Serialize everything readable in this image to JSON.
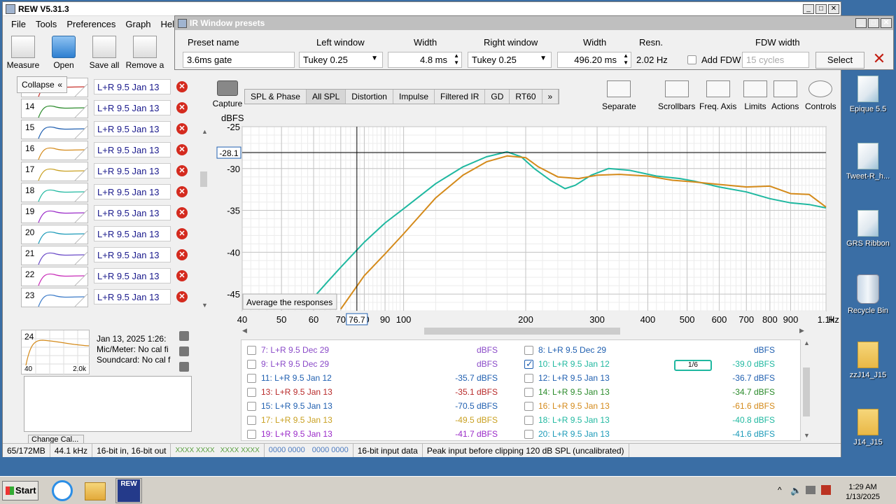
{
  "window": {
    "title": "REW V5.31.3"
  },
  "menu": [
    "File",
    "Tools",
    "Preferences",
    "Graph",
    "Help"
  ],
  "toolbar": [
    "Measure",
    "Open",
    "Save all",
    "Remove a"
  ],
  "leftpanel": {
    "collapse_label": "Collapse",
    "rows": [
      {
        "num": "13",
        "name": "L+R 9.5 Jan 13",
        "color": "#c8302a"
      },
      {
        "num": "14",
        "name": "L+R 9.5 Jan 13",
        "color": "#2a8a2a"
      },
      {
        "num": "15",
        "name": "L+R 9.5 Jan 13",
        "color": "#1f5fb0"
      },
      {
        "num": "16",
        "name": "L+R 9.5 Jan 13",
        "color": "#d48a1a"
      },
      {
        "num": "17",
        "name": "L+R 9.5 Jan 13",
        "color": "#c9a020"
      },
      {
        "num": "18",
        "name": "L+R 9.5 Jan 13",
        "color": "#1fb8a0"
      },
      {
        "num": "19",
        "name": "L+R 9.5 Jan 13",
        "color": "#9a2ac8"
      },
      {
        "num": "20",
        "name": "L+R 9.5 Jan 13",
        "color": "#1a9ab8"
      },
      {
        "num": "21",
        "name": "L+R 9.5 Jan 13",
        "color": "#6a4ac8"
      },
      {
        "num": "22",
        "name": "L+R 9.5 Jan 13",
        "color": "#c82ab8"
      },
      {
        "num": "23",
        "name": "L+R 9.5 Jan 13",
        "color": "#3a7ac8"
      }
    ],
    "selected": {
      "num": "24",
      "axis_start": "40",
      "axis_end": "2.0k",
      "line1": "Jan 13, 2025 1:26:",
      "line2": "Mic/Meter: No cal fi",
      "line3": "Soundcard: No cal f",
      "change_cal": "Change Cal..."
    }
  },
  "ir_presets": {
    "title": "IR Window presets",
    "headers": {
      "preset_name": "Preset name",
      "left_window": "Left window",
      "width": "Width",
      "right_window": "Right window",
      "width2": "Width",
      "resn": "Resn.",
      "fdw_width": "FDW width"
    },
    "preset_value": "3.6ms gate",
    "left_window_value": "Tukey 0.25",
    "left_width": "4.8 ms",
    "right_window_value": "Tukey 0.25",
    "right_width": "496.20 ms",
    "resn_value": "2.02 Hz",
    "add_fdw": "Add FDW",
    "fdw_cycles": "15 cycles",
    "select_label": "Select"
  },
  "graph": {
    "capture_label": "Capture",
    "tabs": [
      "SPL & Phase",
      "All SPL",
      "Distortion",
      "Impulse",
      "Filtered IR",
      "GD",
      "RT60",
      "»"
    ],
    "active_tab": "All SPL",
    "tools": [
      "Separate",
      "Scrollbars",
      "Freq. Axis",
      "Limits",
      "Actions",
      "Controls"
    ],
    "average_label": "Average the responses",
    "cursor_db": "-28.1",
    "cursor_hz": "76.7"
  },
  "chart_data": {
    "type": "line",
    "ylabel": "dBFS",
    "xunit": "kHz",
    "x_log": true,
    "xlim": [
      40,
      1100
    ],
    "ylim": [
      -47,
      -25
    ],
    "x_ticks": [
      "40",
      "50",
      "60",
      "70",
      "80",
      "90",
      "100",
      "200",
      "300",
      "400",
      "500",
      "600",
      "700",
      "800",
      "900",
      "1.1k"
    ],
    "y_ticks": [
      "-25",
      "-30",
      "-35",
      "-40",
      "-45"
    ],
    "cursor": {
      "x": 76.7,
      "y": -28.1
    },
    "grid": true,
    "series": [
      {
        "name": "10: L+R 9.5 Jan 12",
        "color": "#1fb8a0",
        "points": [
          [
            59,
            -45.8
          ],
          [
            65,
            -43.5
          ],
          [
            70,
            -41.8
          ],
          [
            80,
            -38.8
          ],
          [
            90,
            -36.5
          ],
          [
            100,
            -34.8
          ],
          [
            120,
            -31.8
          ],
          [
            140,
            -29.8
          ],
          [
            160,
            -28.6
          ],
          [
            180,
            -28.0
          ],
          [
            195,
            -28.6
          ],
          [
            210,
            -30.0
          ],
          [
            230,
            -31.4
          ],
          [
            250,
            -32.4
          ],
          [
            265,
            -32.0
          ],
          [
            290,
            -30.8
          ],
          [
            320,
            -30.0
          ],
          [
            360,
            -30.2
          ],
          [
            420,
            -30.9
          ],
          [
            480,
            -31.2
          ],
          [
            520,
            -31.5
          ],
          [
            600,
            -32.2
          ],
          [
            700,
            -32.8
          ],
          [
            800,
            -33.6
          ],
          [
            900,
            -34.1
          ],
          [
            1000,
            -34.3
          ],
          [
            1100,
            -34.7
          ]
        ]
      },
      {
        "name": "16: L+R 9.5 Jan 13",
        "color": "#d48a1a",
        "points": [
          [
            70,
            -46.8
          ],
          [
            80,
            -42.8
          ],
          [
            90,
            -40.2
          ],
          [
            100,
            -37.8
          ],
          [
            120,
            -33.5
          ],
          [
            140,
            -30.8
          ],
          [
            160,
            -29.2
          ],
          [
            180,
            -28.5
          ],
          [
            200,
            -28.7
          ],
          [
            215,
            -29.8
          ],
          [
            240,
            -31.0
          ],
          [
            270,
            -31.2
          ],
          [
            300,
            -30.8
          ],
          [
            340,
            -30.7
          ],
          [
            400,
            -30.9
          ],
          [
            460,
            -31.4
          ],
          [
            520,
            -31.6
          ],
          [
            600,
            -31.9
          ],
          [
            700,
            -32.2
          ],
          [
            800,
            -32.1
          ],
          [
            900,
            -33.0
          ],
          [
            1000,
            -33.1
          ],
          [
            1100,
            -34.6
          ]
        ]
      }
    ]
  },
  "meas_table": [
    {
      "cb": false,
      "label": "7: L+R 9.5 Dec 29",
      "value": "dBFS",
      "color": "#8a4ac8",
      "col": 0,
      "row": 0
    },
    {
      "cb": false,
      "label": "8: L+R 9.5 Dec 29",
      "value": "dBFS",
      "color": "#1f5fb0",
      "col": 1,
      "row": 0
    },
    {
      "cb": false,
      "label": "9: L+R 9.5 Dec 29",
      "value": "dBFS",
      "color": "#8a4ac8",
      "col": 0,
      "row": 1
    },
    {
      "cb": true,
      "label": "10: L+R 9.5 Jan 12",
      "value": "-39.0 dBFS",
      "color": "#1fb8a0",
      "col": 1,
      "row": 1
    },
    {
      "cb": false,
      "label": "11: L+R 9.5 Jan 12",
      "value": "-35.7 dBFS",
      "color": "#1f5fb0",
      "col": 0,
      "row": 2
    },
    {
      "cb": false,
      "label": "12: L+R 9.5 Jan 13",
      "value": "-36.7 dBFS",
      "color": "#1f5fb0",
      "col": 1,
      "row": 2
    },
    {
      "cb": false,
      "label": "13: L+R 9.5 Jan 13",
      "value": "-35.1 dBFS",
      "color": "#b82a2a",
      "col": 0,
      "row": 3
    },
    {
      "cb": false,
      "label": "14: L+R 9.5 Jan 13",
      "value": "-34.7 dBFS",
      "color": "#2a8a2a",
      "col": 1,
      "row": 3
    },
    {
      "cb": false,
      "label": "15: L+R 9.5 Jan 13",
      "value": "-70.5 dBFS",
      "color": "#1f5fb0",
      "col": 0,
      "row": 4
    },
    {
      "cb": false,
      "label": "16: L+R 9.5 Jan 13",
      "value": "-61.6 dBFS",
      "color": "#d48a1a",
      "col": 1,
      "row": 4
    },
    {
      "cb": false,
      "label": "17: L+R 9.5 Jan 13",
      "value": "-49.5 dBFS",
      "color": "#c9a020",
      "col": 0,
      "row": 5
    },
    {
      "cb": false,
      "label": "18: L+R 9.5 Jan 13",
      "value": "-40.8 dBFS",
      "color": "#1fb8a0",
      "col": 1,
      "row": 5
    },
    {
      "cb": false,
      "label": "19: L+R 9.5 Jan 13",
      "value": "-41.7 dBFS",
      "color": "#9a2ac8",
      "col": 0,
      "row": 6
    },
    {
      "cb": false,
      "label": "20: L+R 9.5 Jan 13",
      "value": "-41.6 dBFS",
      "color": "#1a9ab8",
      "col": 1,
      "row": 6
    }
  ],
  "smoothing_label": "1/6",
  "statusbar": [
    "65/172MB",
    "44.1 kHz",
    "16-bit in, 16-bit out",
    "XXXX XXXX",
    "XXXX XXXX",
    "0000 0000",
    "0000 0000",
    "16-bit input data",
    "Peak input before clipping 120 dB SPL (uncalibrated)"
  ],
  "desktop_icons": [
    "Epique 5.5",
    "Tweet-R_h...",
    "GRS Ribbon",
    "Recycle Bin",
    "zzJ14_J15",
    "J14_J15"
  ],
  "taskbar": {
    "start": "Start",
    "time": "1:29 AM",
    "date": "1/13/2025",
    "rew_label": "REW"
  }
}
